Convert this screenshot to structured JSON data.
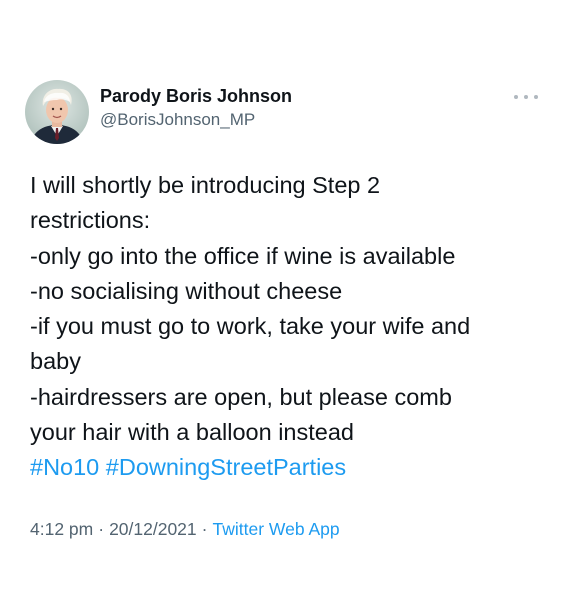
{
  "author": {
    "display_name": "Parody Boris Johnson",
    "handle": "@BorisJohnson_MP",
    "avatar_icon": "profile-photo"
  },
  "tweet": {
    "lines": [
      "I will shortly be introducing Step 2",
      "restrictions:",
      "-only go into the office if wine is available",
      "-no socialising without cheese",
      "-if you must go to work, take your wife and",
      "baby",
      "-hairdressers are open, but please comb",
      "your hair with a balloon instead"
    ],
    "hashtags": [
      "#No10",
      "#DowningStreetParties"
    ]
  },
  "meta": {
    "time": "4:12 pm",
    "separator": "·",
    "date": "20/12/2021",
    "source": "Twitter Web App"
  },
  "colors": {
    "link": "#1d9bf0",
    "secondary_text": "#536471",
    "primary_text": "#0f1419"
  },
  "icons": {
    "more": "more-horizontal-icon"
  }
}
